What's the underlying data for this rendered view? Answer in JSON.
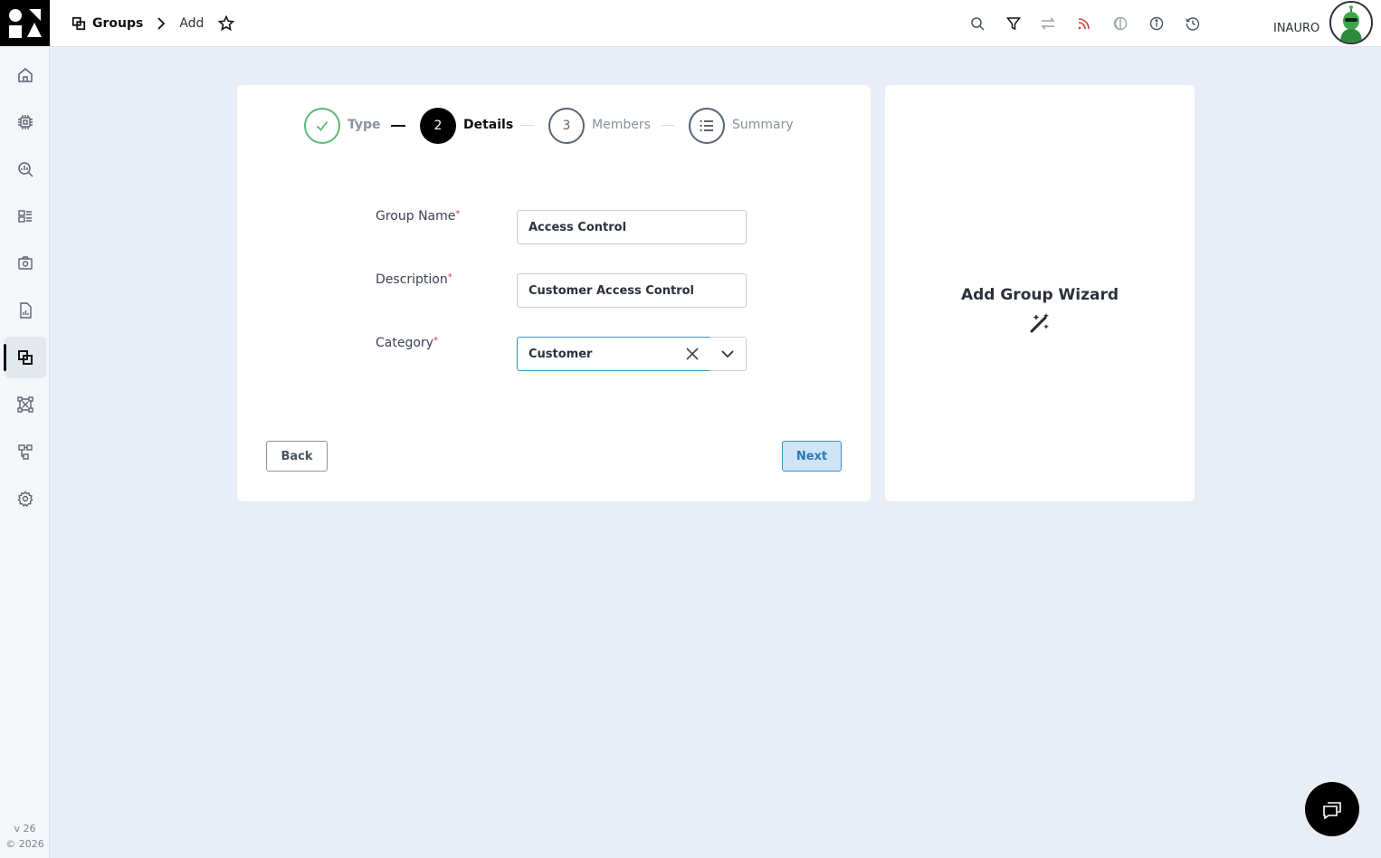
{
  "header": {
    "breadcrumb": {
      "section": "Groups",
      "page": "Add"
    },
    "toolbar_icons": [
      "search-icon",
      "filter-icon",
      "swap-icon",
      "rss-icon",
      "theme-toggle-icon",
      "info-icon",
      "history-icon"
    ],
    "user_name": "INAURO"
  },
  "sidebar": {
    "items": [
      {
        "name": "home",
        "icon": "home-icon"
      },
      {
        "name": "devices",
        "icon": "chip-icon"
      },
      {
        "name": "explore",
        "icon": "analytics-search-icon"
      },
      {
        "name": "dashboards",
        "icon": "dashboard-icon"
      },
      {
        "name": "assets",
        "icon": "camera-box-icon"
      },
      {
        "name": "reports",
        "icon": "report-icon"
      },
      {
        "name": "groups",
        "icon": "groups-icon",
        "active": true
      },
      {
        "name": "zones",
        "icon": "zones-icon"
      },
      {
        "name": "hierarchy",
        "icon": "hierarchy-icon"
      },
      {
        "name": "settings",
        "icon": "gear-icon"
      }
    ],
    "version": "v 26",
    "copyright": "© 2026"
  },
  "wizard": {
    "steps": [
      {
        "label": "Type",
        "state": "complete"
      },
      {
        "label": "Details",
        "number": "2",
        "state": "active"
      },
      {
        "label": "Members",
        "number": "3",
        "state": "pending"
      },
      {
        "label": "Summary",
        "state": "pending"
      }
    ],
    "fields": {
      "group_name": {
        "label": "Group Name",
        "required_mark": "*",
        "value": "Access Control"
      },
      "description": {
        "label": "Description",
        "required_mark": "*",
        "value": "Customer Access Control"
      },
      "category": {
        "label": "Category",
        "required_mark": "*",
        "value": "Customer"
      }
    },
    "buttons": {
      "back": "Back",
      "next": "Next"
    }
  },
  "side_panel": {
    "title": "Add Group Wizard",
    "icon": "magic-wand-icon"
  },
  "chat": {
    "icon": "chat-icon"
  },
  "colors": {
    "accent": "#3f8fc4",
    "success": "#5cb87a",
    "active_step": "#000000"
  }
}
